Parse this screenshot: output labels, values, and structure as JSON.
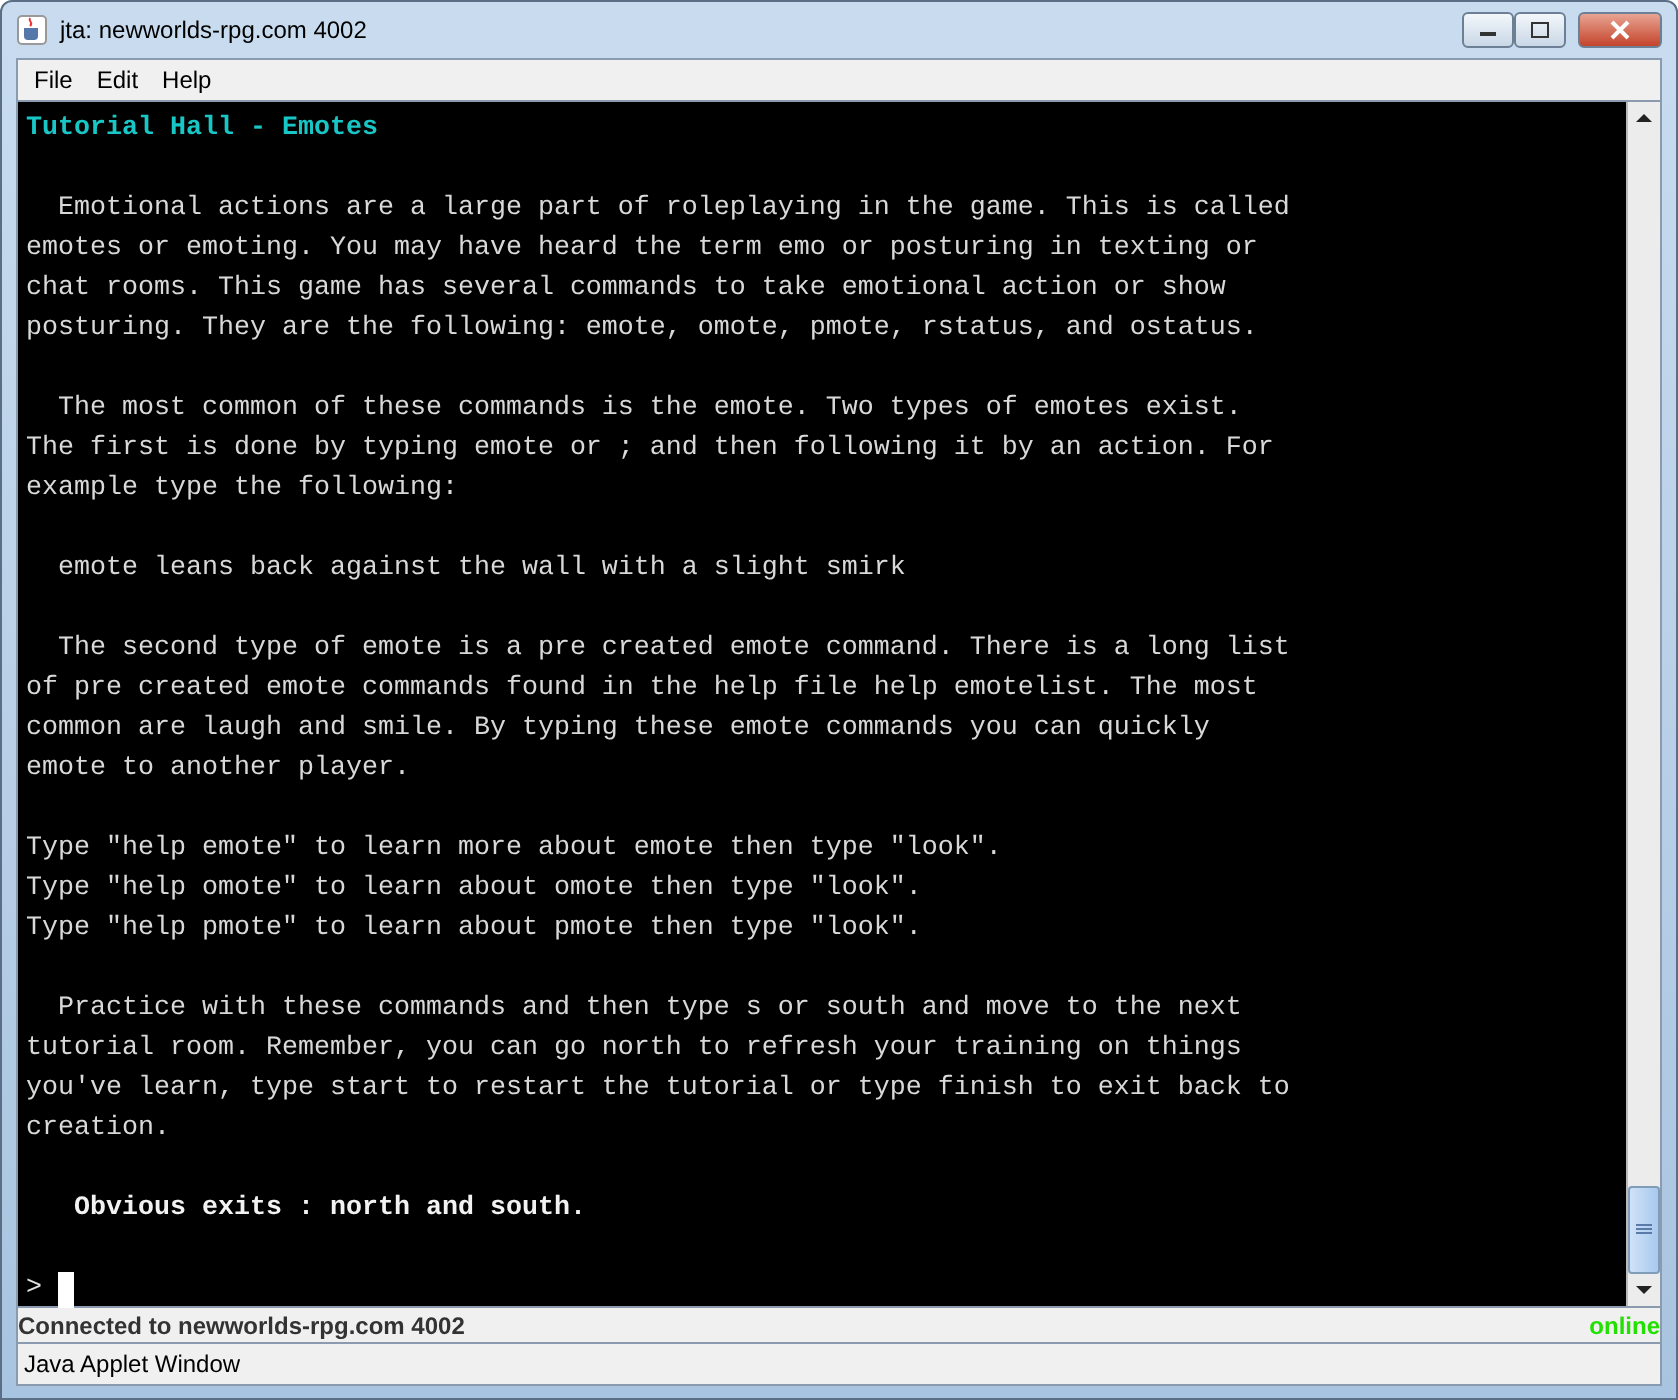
{
  "window": {
    "title": "jta: newworlds-rpg.com 4002"
  },
  "menu": [
    "File",
    "Edit",
    "Help"
  ],
  "terminal": {
    "blocks": [
      {
        "kind": "heading",
        "lines": [
          "Tutorial Hall - Emotes"
        ]
      },
      {
        "kind": "text",
        "lines": [
          "  Emotional actions are a large part of roleplaying in the game. This is called",
          "emotes or emoting. You may have heard the term emo or posturing in texting or",
          "chat rooms. This game has several commands to take emotional action or show",
          "posturing. They are the following: emote, omote, pmote, rstatus, and ostatus."
        ]
      },
      {
        "kind": "text",
        "lines": [
          "  The most common of these commands is the emote. Two types of emotes exist.",
          "The first is done by typing emote or ; and then following it by an action. For",
          "example type the following:"
        ]
      },
      {
        "kind": "text",
        "lines": [
          "  emote leans back against the wall with a slight smirk"
        ]
      },
      {
        "kind": "text",
        "lines": [
          "  The second type of emote is a pre created emote command. There is a long list",
          "of pre created emote commands found in the help file help emotelist. The most",
          "common are laugh and smile. By typing these emote commands you can quickly",
          "emote to another player."
        ]
      },
      {
        "kind": "text",
        "lines": [
          "Type \"help emote\" to learn more about emote then type \"look\".",
          "Type \"help omote\" to learn about omote then type \"look\".",
          "Type \"help pmote\" to learn about pmote then type \"look\"."
        ]
      },
      {
        "kind": "text",
        "lines": [
          "  Practice with these commands and then type s or south and move to the next",
          "tutorial room. Remember, you can go north to refresh your training on things",
          "you've learn, type start to restart the tutorial or type finish to exit back to",
          "creation."
        ]
      },
      {
        "kind": "exits",
        "lines": [
          "   Obvious exits : north and south."
        ]
      }
    ],
    "prompt": ">"
  },
  "status_bar": {
    "connection": "Connected to newworlds-rpg.com 4002",
    "state": "online"
  },
  "applet_warning": "Java Applet Window"
}
